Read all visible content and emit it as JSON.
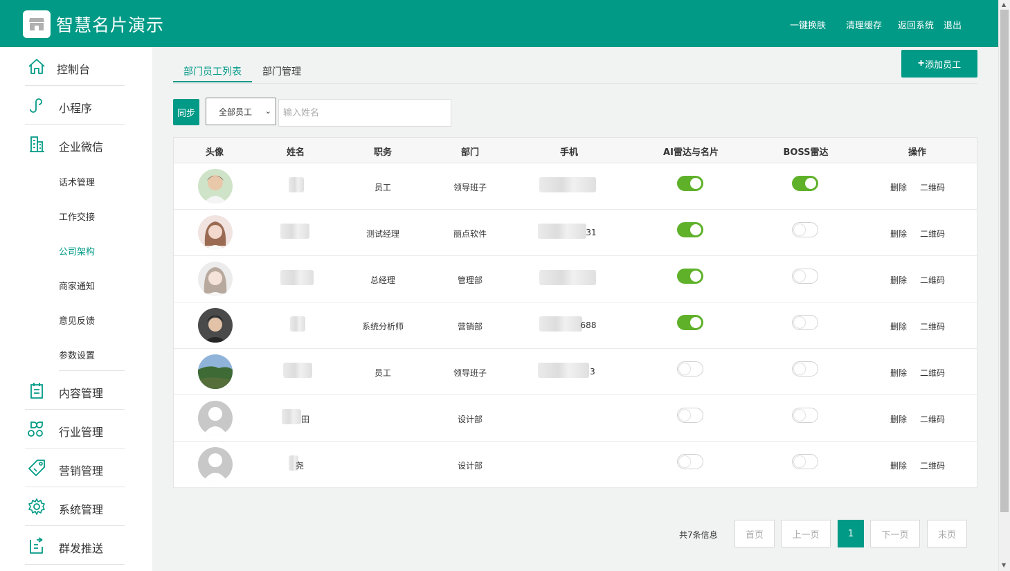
{
  "header": {
    "app_title": "智慧名片演示",
    "nav": [
      "一键换肤",
      "清理缓存",
      "返回系统",
      "退出"
    ]
  },
  "sidebar": {
    "main_items": [
      {
        "label": "控制台",
        "icon": "home-icon"
      },
      {
        "label": "小程序",
        "icon": "mini-program-icon"
      },
      {
        "label": "企业微信",
        "icon": "building-icon"
      }
    ],
    "sub_items": [
      "话术管理",
      "工作交接",
      "公司架构",
      "商家通知",
      "意见反馈",
      "参数设置"
    ],
    "active_sub": "公司架构",
    "bottom_items": [
      {
        "label": "内容管理",
        "icon": "clipboard-icon"
      },
      {
        "label": "行业管理",
        "icon": "grid-icon"
      },
      {
        "label": "营销管理",
        "icon": "tag-icon"
      },
      {
        "label": "系统管理",
        "icon": "gear-icon"
      },
      {
        "label": "群发推送",
        "icon": "share-icon"
      }
    ]
  },
  "tabs": [
    "部门员工列表",
    "部门管理"
  ],
  "add_button": "添加员工",
  "filters": {
    "sync_label": "同步",
    "select_value": "全部员工",
    "name_placeholder": "输入姓名"
  },
  "table": {
    "headers": [
      "头像",
      "姓名",
      "职务",
      "部门",
      "手机",
      "AI雷达与名片",
      "BOSS雷达",
      "操作"
    ],
    "rows": [
      {
        "name": "",
        "position": "员工",
        "dept": "领导班子",
        "phone": "",
        "ai_radar": true,
        "boss_radar": true
      },
      {
        "name": "",
        "position": "测试经理",
        "dept": "丽点软件",
        "phone": "31",
        "ai_radar": true,
        "boss_radar": false
      },
      {
        "name": "",
        "position": "总经理",
        "dept": "管理部",
        "phone": "",
        "ai_radar": true,
        "boss_radar": false
      },
      {
        "name": "",
        "position": "系统分析师",
        "dept": "营销部",
        "phone": "688",
        "ai_radar": true,
        "boss_radar": false
      },
      {
        "name": "",
        "position": "员工",
        "dept": "领导班子",
        "phone": "3",
        "ai_radar": false,
        "boss_radar": false
      },
      {
        "name": "田",
        "position": "",
        "dept": "设计部",
        "phone": "",
        "ai_radar": false,
        "boss_radar": false
      },
      {
        "name": "尧",
        "position": "",
        "dept": "设计部",
        "phone": "",
        "ai_radar": false,
        "boss_radar": false
      }
    ],
    "ops": [
      "删除",
      "二维码"
    ]
  },
  "pagination": {
    "info": "共7条信息",
    "first": "首页",
    "prev": "上一页",
    "current": "1",
    "next": "下一页",
    "last": "末页"
  },
  "colors": {
    "brand": "#009a86",
    "toggle_on": "#5fb12a"
  }
}
